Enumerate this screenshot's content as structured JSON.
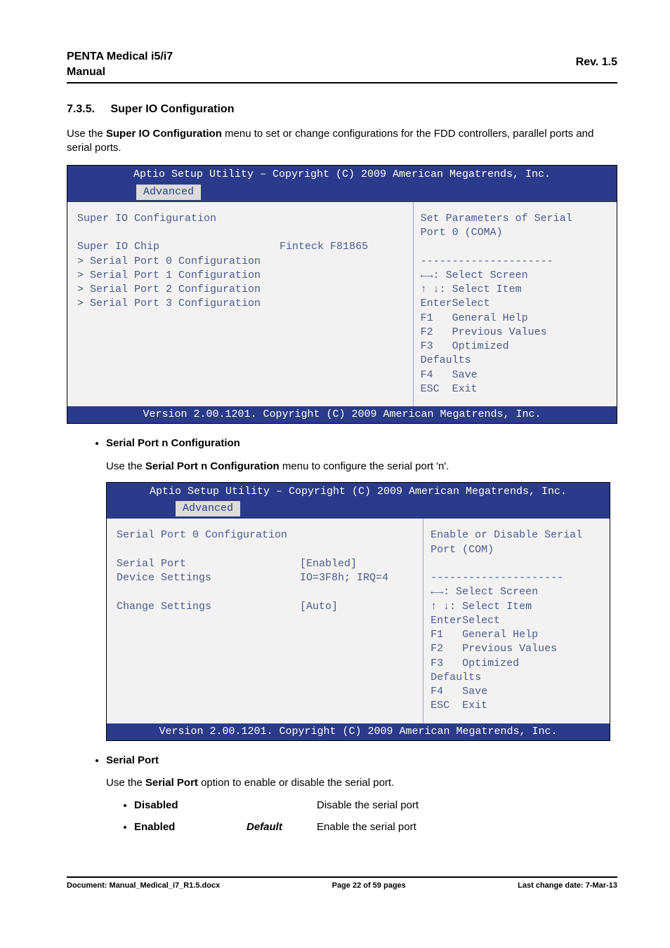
{
  "header": {
    "product": "PENTA Medical i5/i7",
    "doc_type": "Manual",
    "revision": "Rev. 1.5"
  },
  "section": {
    "number": "7.3.5.",
    "title": "Super IO Configuration",
    "intro_pre": "Use the ",
    "intro_bold": "Super IO Configuration",
    "intro_post": " menu to set or change configurations for the FDD controllers, parallel ports and serial ports."
  },
  "bios1": {
    "title": "Aptio Setup Utility – Copyright (C) 2009 American Megatrends, Inc.",
    "tab": "Advanced",
    "left": "Super IO Configuration\n\nSuper IO Chip                   Finteck F81865\n> Serial Port 0 Configuration\n> Serial Port 1 Configuration\n> Serial Port 2 Configuration\n> Serial Port 3 Configuration",
    "right_top": "Set Parameters of Serial\nPort 0 (COMA)\n\n",
    "right_sep": "---------------------",
    "right_keys": "←→: Select Screen\n↑ ↓: Select Item\nEnterSelect\nF1   General Help\nF2   Previous Values\nF3   Optimized\nDefaults\nF4   Save\nESC  Exit",
    "footer": "Version 2.00.1201. Copyright (C) 2009 American Megatrends, Inc."
  },
  "serial_port_n": {
    "bullet": "Serial Port n Configuration",
    "para_pre": "Use the ",
    "para_bold": "Serial Port n Configuration",
    "para_post": " menu to configure the serial port 'n'."
  },
  "bios2": {
    "title": "Aptio Setup Utility – Copyright (C) 2009 American Megatrends, Inc.",
    "tab": "Advanced",
    "left": "Serial Port 0 Configuration\n\nSerial Port                  [Enabled]\nDevice Settings              IO=3F8h; IRQ=4\n\nChange Settings              [Auto]",
    "right_top": "Enable or Disable Serial\nPort (COM)\n\n",
    "right_sep": "---------------------",
    "right_keys": "←→: Select Screen\n↑ ↓: Select Item\nEnterSelect\nF1   General Help\nF2   Previous Values\nF3   Optimized\nDefaults\nF4   Save\nESC  Exit",
    "footer": "Version 2.00.1201. Copyright (C) 2009 American Megatrends, Inc."
  },
  "serial_port": {
    "bullet": "Serial Port",
    "para_pre": "Use the ",
    "para_bold": "Serial Port",
    "para_post": " option to enable or disable the serial port.",
    "options": [
      {
        "name": "Disabled",
        "default": "",
        "desc": "Disable the serial port"
      },
      {
        "name": "Enabled",
        "default": "Default",
        "desc": "Enable the serial port"
      }
    ]
  },
  "footer": {
    "doc": "Document: Manual_Medical_i7_R1.5.docx",
    "page": "Page 22 of 59 pages",
    "date": "Last change date: 7-Mar-13"
  }
}
